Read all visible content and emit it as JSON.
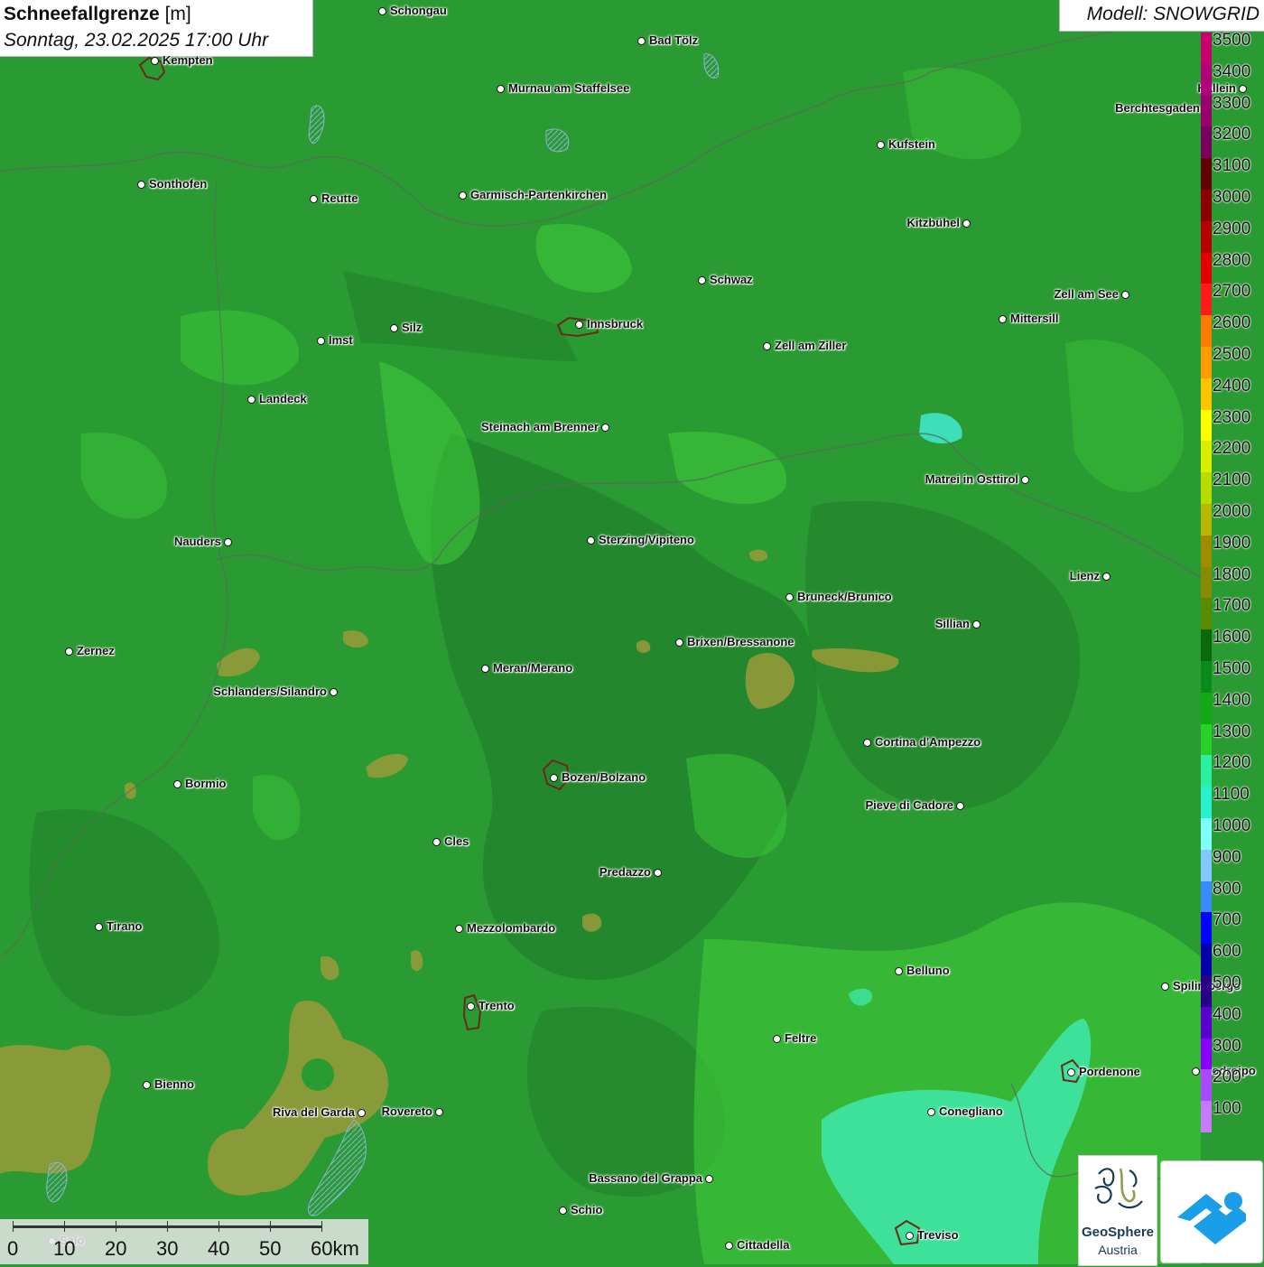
{
  "title": {
    "main": "Schneefallgrenze",
    "unit": "[m]",
    "date": "Sonntag, 23.02.2025 17:00 Uhr"
  },
  "model": "Modell: SNOWGRID",
  "colors": {
    "base_green": "#2a9a32",
    "dark_green": "#1f7d2a",
    "light_green": "#3fd23a",
    "olive": "#9a9a3a",
    "teal": "#3fe6a4"
  },
  "legend": {
    "labels": [
      "3500",
      "3400",
      "3300",
      "3200",
      "3100",
      "3000",
      "2900",
      "2800",
      "2700",
      "2600",
      "2500",
      "2400",
      "2300",
      "2200",
      "2100",
      "2000",
      "1900",
      "1800",
      "1700",
      "1600",
      "1500",
      "1400",
      "1300",
      "1200",
      "1100",
      "1000",
      "900",
      "800",
      "700",
      "600",
      "500",
      "400",
      "300",
      "200",
      "100"
    ],
    "colors": [
      "#c8006e",
      "#b0007a",
      "#980070",
      "#7a0060",
      "#600000",
      "#8a0000",
      "#b40000",
      "#e00000",
      "#ff1a1a",
      "#ff7a00",
      "#ff9a00",
      "#ffc400",
      "#ffff00",
      "#d8f000",
      "#b8dc00",
      "#b8b800",
      "#a08a00",
      "#8a8a00",
      "#5a8a00",
      "#0a6a0a",
      "#0a8a1a",
      "#12aa12",
      "#2ad02a",
      "#2af0a0",
      "#2af0d0",
      "#80ffff",
      "#80c8ff",
      "#3a8aff",
      "#0000ff",
      "#0000aa",
      "#2a0088",
      "#5a00cc",
      "#8a00ff",
      "#a84aff",
      "#c87aff"
    ]
  },
  "cities": [
    {
      "name": "Schongau",
      "side": "r"
    },
    {
      "name": "Kempten",
      "side": "r"
    },
    {
      "name": "Bad Tölz",
      "side": "r"
    },
    {
      "name": "Murnau am Staffelsee",
      "side": "r"
    },
    {
      "name": "Hallein",
      "side": "l"
    },
    {
      "name": "Berchtesgaden",
      "side": "l"
    },
    {
      "name": "Kufstein",
      "side": "r"
    },
    {
      "name": "Sonthofen",
      "side": "r"
    },
    {
      "name": "Reutte",
      "side": "r"
    },
    {
      "name": "Garmisch-Partenkirchen",
      "side": "r"
    },
    {
      "name": "Kitzbühel",
      "side": "l"
    },
    {
      "name": "Schwaz",
      "side": "r"
    },
    {
      "name": "Zell am See",
      "side": "l"
    },
    {
      "name": "Innsbruck",
      "side": "r"
    },
    {
      "name": "Silz",
      "side": "r"
    },
    {
      "name": "Imst",
      "side": "r"
    },
    {
      "name": "Mittersill",
      "side": "r"
    },
    {
      "name": "Zell am Ziller",
      "side": "r"
    },
    {
      "name": "Landeck",
      "side": "r"
    },
    {
      "name": "Steinach am Brenner",
      "side": "l"
    },
    {
      "name": "Matrei in Osttirol",
      "side": "l"
    },
    {
      "name": "Nauders",
      "side": "l"
    },
    {
      "name": "Sterzing/Vipiteno",
      "side": "r"
    },
    {
      "name": "Lienz",
      "side": "l"
    },
    {
      "name": "Bruneck/Brunico",
      "side": "r"
    },
    {
      "name": "Sillian",
      "side": "l"
    },
    {
      "name": "Brixen/Bressanone",
      "side": "r"
    },
    {
      "name": "Zernez",
      "side": "r"
    },
    {
      "name": "Meran/Merano",
      "side": "r"
    },
    {
      "name": "Schlanders/Silandro",
      "side": "l"
    },
    {
      "name": "Cortina d'Ampezzo",
      "side": "r"
    },
    {
      "name": "Bozen/Bolzano",
      "side": "r"
    },
    {
      "name": "Bormio",
      "side": "r"
    },
    {
      "name": "Pieve di Cadore",
      "side": "l"
    },
    {
      "name": "Cles",
      "side": "r"
    },
    {
      "name": "Predazzo",
      "side": "l"
    },
    {
      "name": "Tirano",
      "side": "r"
    },
    {
      "name": "Mezzolombardo",
      "side": "r"
    },
    {
      "name": "Belluno",
      "side": "r"
    },
    {
      "name": "Spilimbergo",
      "side": "r"
    },
    {
      "name": "Trento",
      "side": "r"
    },
    {
      "name": "Feltre",
      "side": "r"
    },
    {
      "name": "Pordenone",
      "side": "r"
    },
    {
      "name": "Codroipo",
      "side": "r"
    },
    {
      "name": "Bienno",
      "side": "r"
    },
    {
      "name": "Riva del Garda",
      "side": "l"
    },
    {
      "name": "Rovereto",
      "side": "l"
    },
    {
      "name": "Conegliano",
      "side": "r"
    },
    {
      "name": "Bassano del Grappa",
      "side": "l"
    },
    {
      "name": "Schio",
      "side": "r"
    },
    {
      "name": "Treviso",
      "side": "r"
    },
    {
      "name": "Cittadella",
      "side": "r"
    },
    {
      "name": "Salò",
      "side": "r"
    }
  ],
  "scale": {
    "labels": [
      "0",
      "10",
      "20",
      "30",
      "40",
      "50",
      "60km"
    ]
  },
  "logos": {
    "geosphere_name": "GeoSphere",
    "geosphere_sub": "Austria"
  }
}
